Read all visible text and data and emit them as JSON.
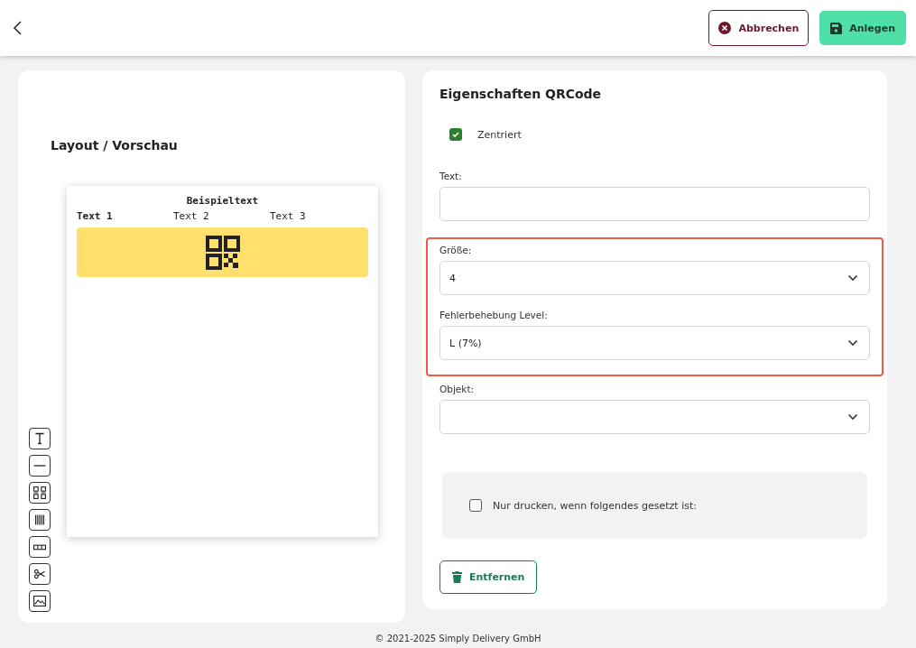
{
  "header": {
    "buttons": [
      {
        "label": "Abbrechen",
        "kind": "cancel"
      },
      {
        "label": "Anlegen",
        "kind": "save"
      }
    ]
  },
  "preview": {
    "title": "Layout / Vorschau",
    "label_title": "Beispieltext",
    "columns": [
      {
        "label": "Text 1",
        "bold": true
      },
      {
        "label": "Text 2",
        "bold": false
      },
      {
        "label": "Text 3",
        "bold": false
      }
    ],
    "tools": [
      {
        "kind": "text"
      },
      {
        "kind": "line"
      },
      {
        "kind": "qrcode"
      },
      {
        "kind": "barcode"
      },
      {
        "kind": "table"
      },
      {
        "kind": "cut"
      },
      {
        "kind": "image"
      }
    ]
  },
  "properties": {
    "title": "Eigenschaften QRCode",
    "centered": {
      "label": "Zentriert",
      "checked": true
    },
    "fields": [
      {
        "label": "Text:",
        "kind": "input",
        "highlighted": false
      },
      {
        "label": "Größe:",
        "kind": "select",
        "value": "4",
        "highlighted": true
      },
      {
        "label": "Fehlerbehebung Level:",
        "kind": "select",
        "value": "L (7%)",
        "highlighted": true
      },
      {
        "label": "Objekt:",
        "kind": "select",
        "highlighted": false
      }
    ],
    "condition": {
      "label": "Nur drucken, wenn folgendes gesetzt ist:",
      "checked": false
    },
    "remove_button": "Entfernen"
  },
  "footer": "© 2021-2025 Simply Delivery GmbH"
}
